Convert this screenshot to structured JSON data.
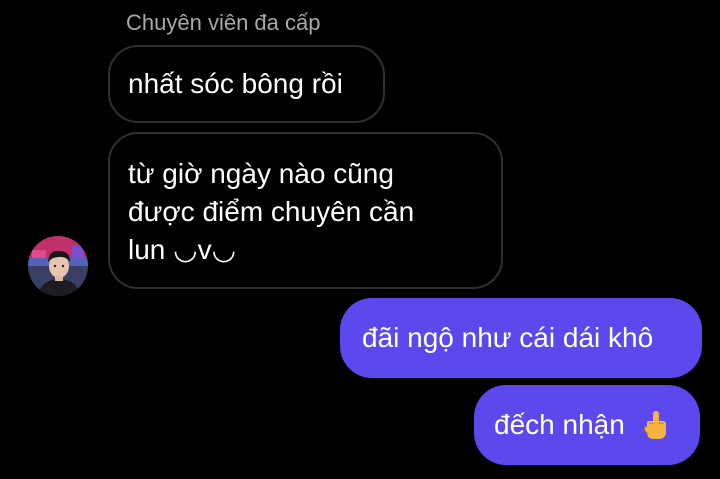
{
  "conversation": {
    "sender_name": "Chuyên viên đa cấp",
    "incoming": [
      {
        "text": "nhất sóc bông rồi"
      },
      {
        "lines": [
          "từ giờ ngày nào cũng",
          "được điểm chuyên cần",
          "lun ◡v◡"
        ]
      }
    ],
    "outgoing": [
      {
        "text": "đãi ngộ như cái dái khô"
      },
      {
        "text": "đếch nhận",
        "emoji": "middle-finger-emoji"
      }
    ]
  },
  "colors": {
    "background": "#000000",
    "incoming_border": "#2f2f2f",
    "outgoing_bubble": "#5b49ee",
    "sender_name": "#a8a8a8",
    "message_text": "#ffffff"
  },
  "icons": {
    "avatar": "user-avatar-photo",
    "emoji": "middle-finger-emoji"
  }
}
